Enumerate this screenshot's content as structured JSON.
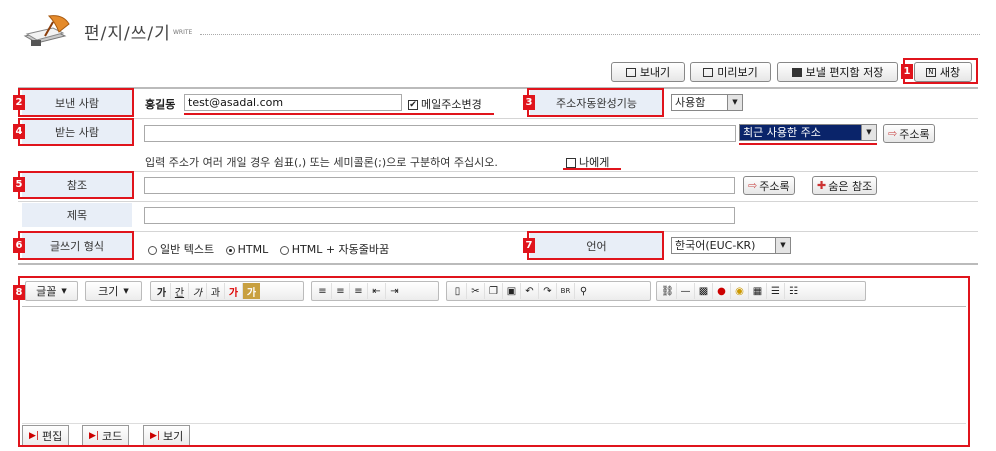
{
  "header": {
    "title": "편/지/쓰/기",
    "subtitle": "WRITE"
  },
  "toolbar": {
    "send_label": "보내기",
    "preview_label": "미리보기",
    "save_label": "보낼 편지함 저장",
    "new_window_label": "새창"
  },
  "badges": [
    "1",
    "2",
    "3",
    "4",
    "5",
    "6",
    "7",
    "8"
  ],
  "form": {
    "sender": {
      "label": "보낸 사람",
      "name": "홍길동",
      "email": "test@asadal.com",
      "change_label": "메일주소변경",
      "change_checked": true
    },
    "autocomplete": {
      "label": "주소자동완성기능",
      "value": "사용함"
    },
    "recipient": {
      "label": "받는 사람",
      "value": "",
      "recent_select": "최근 사용한 주소",
      "addressbook_label": "주소록"
    },
    "hint": {
      "text": "입력 주소가 여러 개일 경우 쉼표(,) 또는 세미콜론(;)으로 구분하여 주십시오.",
      "to_me_label": "나에게",
      "to_me_checked": false
    },
    "cc": {
      "label": "참조",
      "value": "",
      "addressbook_label": "주소록",
      "bcc_label": "숨은 참조"
    },
    "subject": {
      "label": "제목",
      "value": ""
    },
    "format": {
      "label": "글쓰기 형식",
      "options": [
        "일반 텍스트",
        "HTML",
        "HTML + 자동줄바꿈"
      ],
      "selected": "HTML"
    },
    "language": {
      "label": "언어",
      "value": "한국어(EUC-KR)"
    }
  },
  "editor": {
    "font_label": "글꼴",
    "size_label": "크기",
    "format_buttons": [
      "가",
      "간",
      "가",
      "과",
      "가",
      "가"
    ],
    "content": "",
    "mode_tabs": [
      "편집",
      "코드",
      "보기"
    ]
  },
  "colors": {
    "annotation_red": "#e0141c",
    "label_bg": "#e8eef7",
    "recent_select_bg": "#0a246a"
  }
}
